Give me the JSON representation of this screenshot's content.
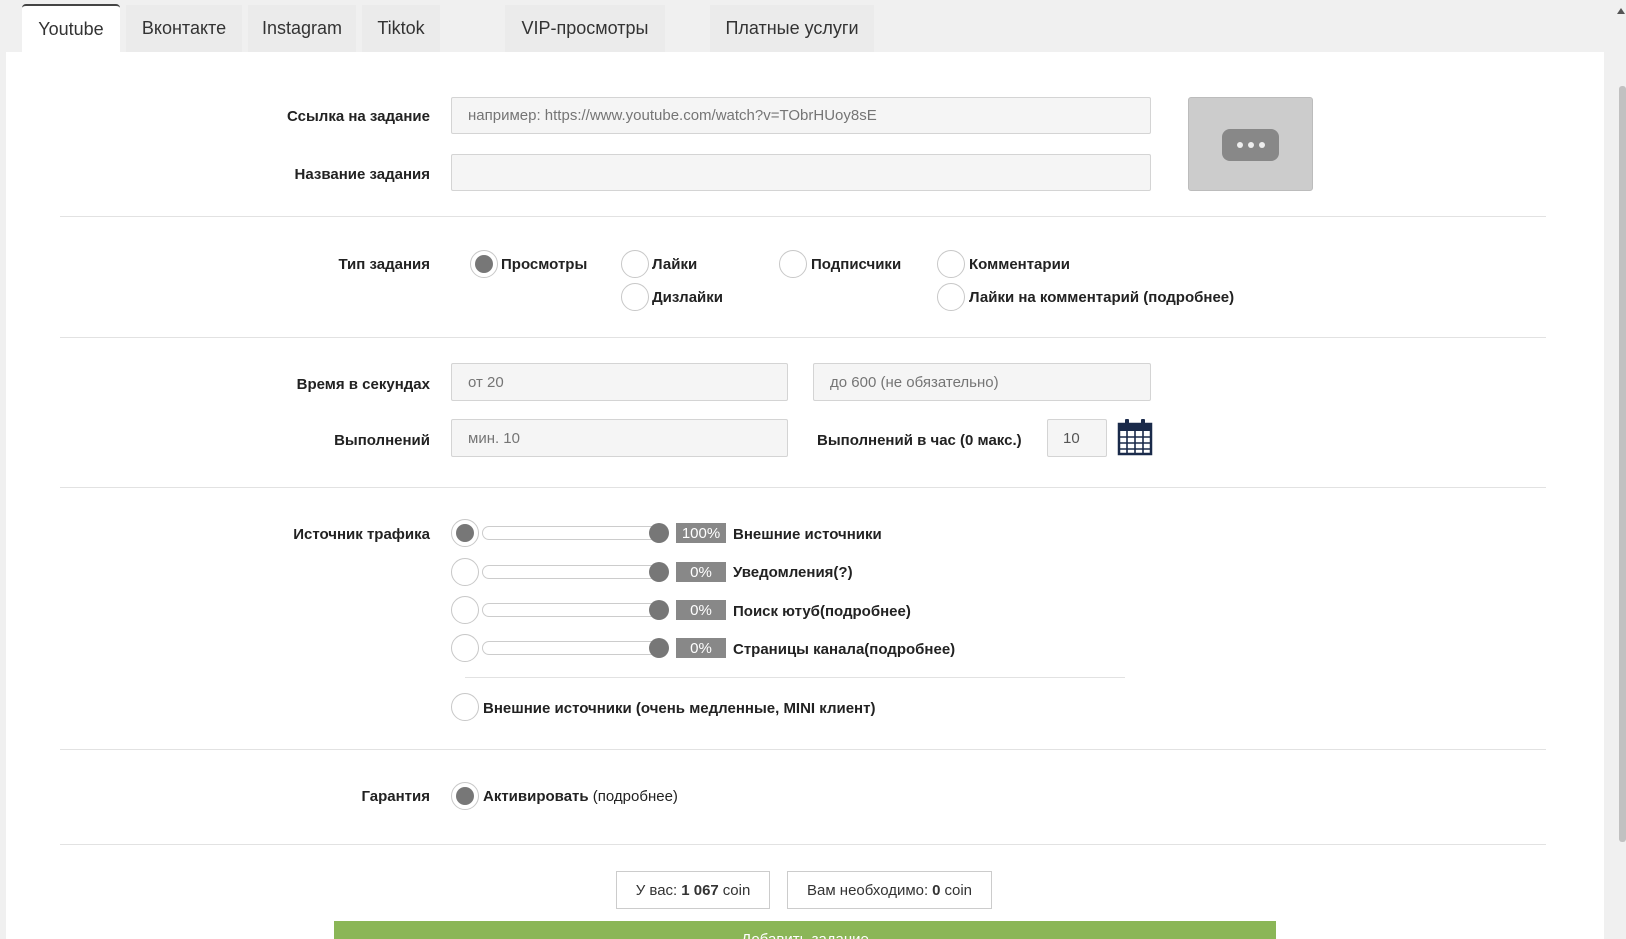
{
  "tabs": [
    {
      "label": "Youtube",
      "active": true
    },
    {
      "label": "Вконтакте"
    },
    {
      "label": "Instagram"
    },
    {
      "label": "Tiktok"
    },
    {
      "label": "VIP-просмотры"
    },
    {
      "label": "Платные услуги"
    }
  ],
  "form": {
    "link_label": "Ссылка на задание",
    "link_placeholder": "например: https://www.youtube.com/watch?v=TObrHUoy8sE",
    "name_label": "Название задания",
    "name_value": "",
    "type_label": "Тип задания",
    "types": {
      "views": "Просмотры",
      "likes": "Лайки",
      "subscribers": "Подписчики",
      "comments": "Комментарии",
      "dislikes": "Дизлайки",
      "comment_likes": "Лайки на комментарий (подробнее)"
    },
    "selected_type": "views",
    "time_label": "Время в секундах",
    "time_from_placeholder": "от 20",
    "time_to_placeholder": "до 600 (не обязательно)",
    "runs_label": "Выполнений",
    "runs_placeholder": "мин. 10",
    "per_hour_label": "Выполнений в час (0 макс.)",
    "per_hour_value": "10",
    "traffic_label": "Источник трафика",
    "traffic_sources": [
      {
        "label": "Внешние источники",
        "percent_text": "100%",
        "selected": true
      },
      {
        "label": "Уведомления(?)",
        "percent_text": "0%",
        "selected": false
      },
      {
        "label": "Поиск ютуб(подробнее)",
        "percent_text": "0%",
        "selected": false
      },
      {
        "label": "Страницы канала(подробнее)",
        "percent_text": "0%",
        "selected": false
      }
    ],
    "mini_client_label": "Внешние источники (очень медленные, MINI клиент)",
    "guarantee_label": "Гарантия",
    "guarantee_option_bold": "Активировать",
    "guarantee_option_more": "(подробнее)",
    "guarantee_selected": true
  },
  "balance": {
    "have_prefix": "У вас:",
    "have_amount": "1 067",
    "have_unit": "coin",
    "need_prefix": "Вам необходимо:",
    "need_amount": "0",
    "need_unit": "coin"
  },
  "submit_label": "Добавить задание",
  "icons": {
    "more": "more-dots-icon",
    "calendar": "calendar-icon"
  },
  "colors": {
    "submit": "#8bb657",
    "radio_selected": "#777777"
  }
}
